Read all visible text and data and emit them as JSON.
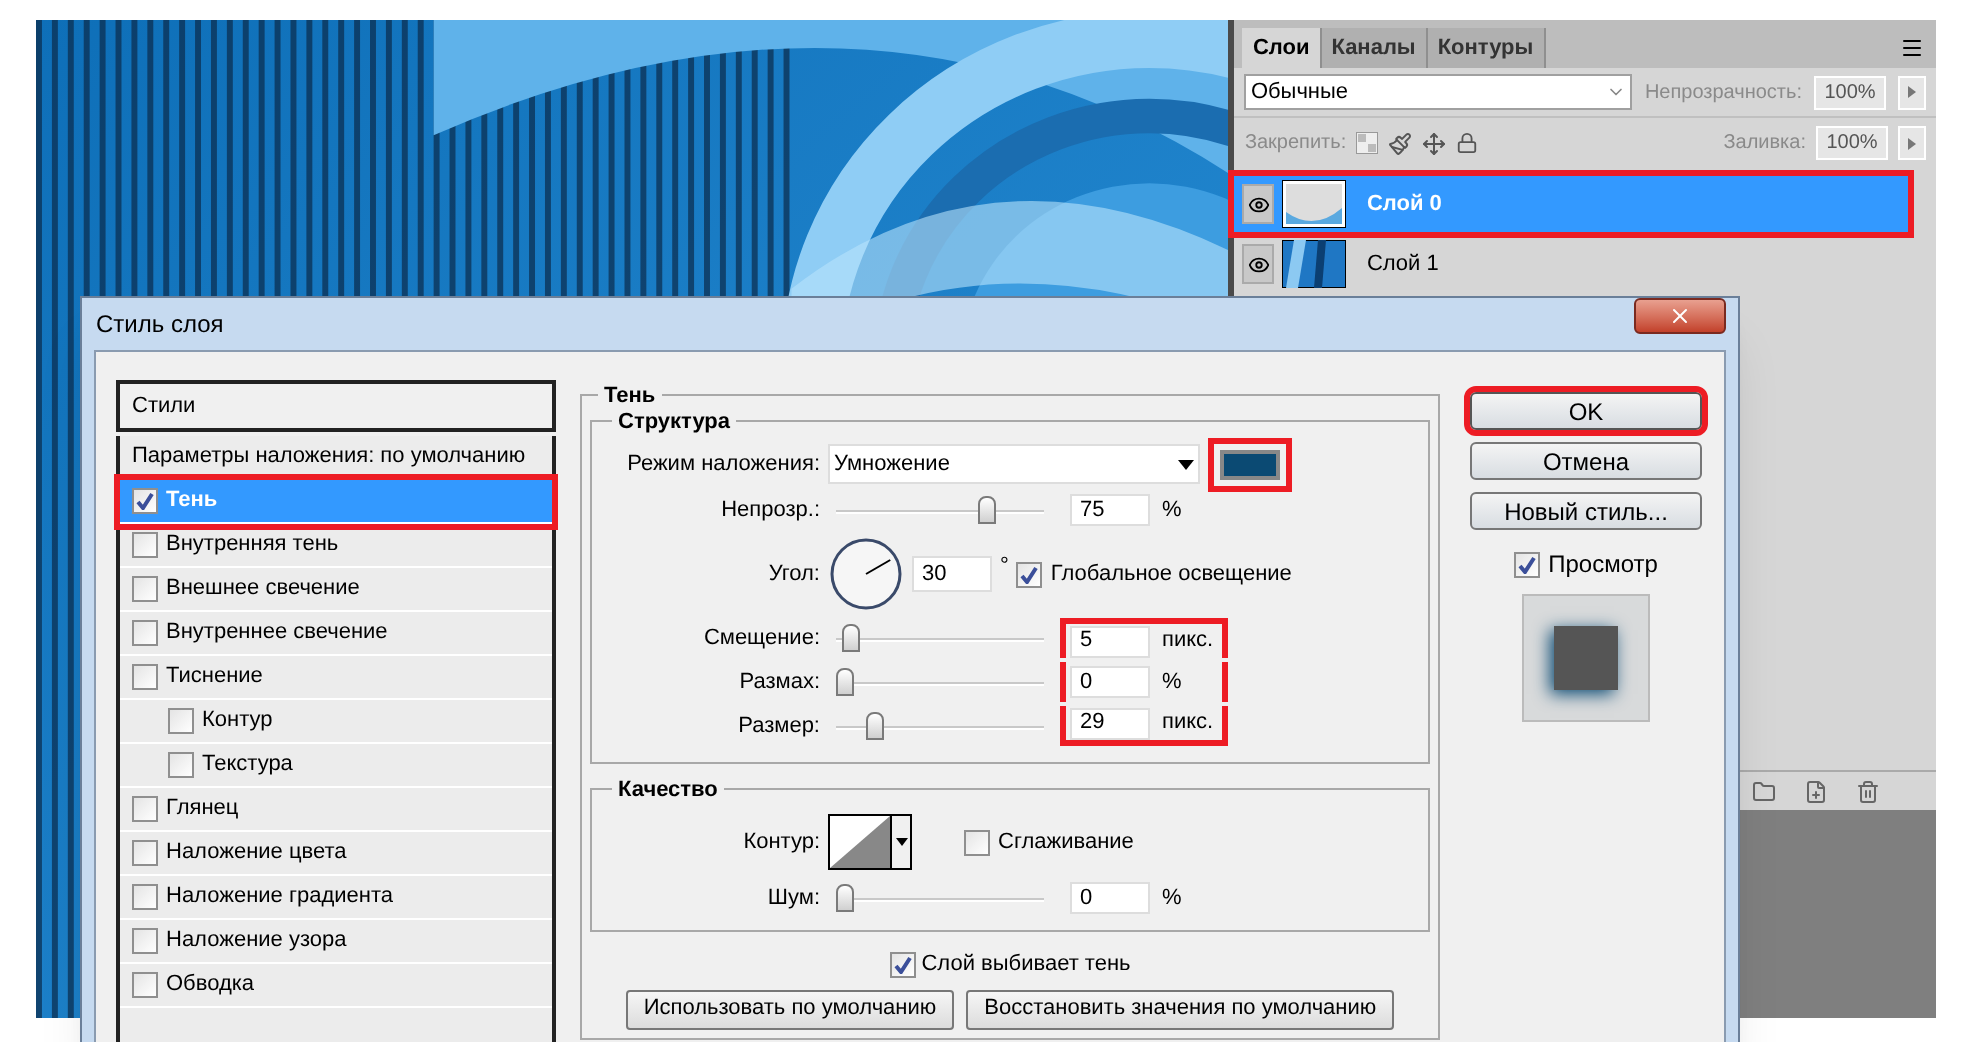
{
  "layers_panel": {
    "tabs": [
      {
        "label": "Слои",
        "selected": true
      },
      {
        "label": "Каналы",
        "selected": false
      },
      {
        "label": "Контуры",
        "selected": false
      }
    ],
    "blend_mode": "Обычные",
    "opacity_label": "Непрозрачность:",
    "opacity": "100%",
    "lock_label": "Закрепить:",
    "fill_label": "Заливка:",
    "fill": "100%",
    "layers": [
      {
        "name": "Слой 0",
        "kind": "transparent",
        "selected": true,
        "visible": true,
        "highlighted": true
      },
      {
        "name": "Слой 1",
        "selected": false,
        "visible": true,
        "highlighted": false
      }
    ]
  },
  "dialog": {
    "title": "Стиль слоя",
    "styles_header": "Стили",
    "blend_options": "Параметры наложения: по умолчанию",
    "styles": [
      {
        "label": "Тень",
        "checked": true,
        "selected": true,
        "highlighted": true
      },
      {
        "label": "Внутренняя тень",
        "checked": false,
        "selected": false,
        "highlighted": false
      },
      {
        "label": "Внешнее свечение",
        "checked": false,
        "selected": false,
        "highlighted": false
      },
      {
        "label": "Внутреннее свечение",
        "checked": false,
        "selected": false,
        "highlighted": false
      },
      {
        "label": "Тиснение",
        "checked": false,
        "selected": false,
        "highlighted": false,
        "children": [
          {
            "label": "Контур",
            "checked": false,
            "selected": false,
            "highlighted": false
          },
          {
            "label": "Текстура",
            "checked": false,
            "selected": false,
            "highlighted": false
          }
        ]
      },
      {
        "label": "Глянец",
        "checked": false,
        "selected": false,
        "highlighted": false
      },
      {
        "label": "Наложение цвета",
        "checked": false,
        "selected": false,
        "highlighted": false
      },
      {
        "label": "Наложение градиента",
        "checked": false,
        "selected": false,
        "highlighted": false
      },
      {
        "label": "Наложение узора",
        "checked": false,
        "selected": false,
        "highlighted": false
      },
      {
        "label": "Обводка",
        "checked": false,
        "selected": false,
        "highlighted": false
      }
    ],
    "section_title": "Тень",
    "structure": {
      "title": "Структура",
      "blend_label": "Режим наложения:",
      "blend_value": "Умножение",
      "color": "#0b4a73",
      "color_highlighted": true,
      "rows": [
        {
          "kind": "slider",
          "label": "Непрозр.:",
          "level": 0.75,
          "value": "75",
          "unit": "%",
          "highlighted": false
        },
        {
          "kind": "angle",
          "label": "Угол:",
          "value": "30",
          "unit": "°",
          "checkbox": {
            "label": "Глобальное освещение",
            "checked": true
          }
        },
        {
          "kind": "slider",
          "label": "Смещение:",
          "level": 0.03,
          "value": "5",
          "unit": "пикс.",
          "highlighted": true
        },
        {
          "kind": "slider",
          "label": "Размах:",
          "level": 0,
          "value": "0",
          "unit": "%",
          "highlighted": true
        },
        {
          "kind": "slider",
          "label": "Размер:",
          "level": 0.16,
          "value": "29",
          "unit": "пикс.",
          "highlighted": true
        }
      ]
    },
    "quality": {
      "title": "Качество",
      "contour_label": "Контур:",
      "antialias": {
        "label": "Сглаживание",
        "checked": false
      },
      "noise": {
        "label": "Шум:",
        "level": 0,
        "value": "0",
        "unit": "%"
      }
    },
    "knockout": {
      "label": "Слой выбивает тень",
      "checked": true
    },
    "bottom_buttons": [
      "Использовать по умолчанию",
      "Восстановить значения по умолчанию"
    ],
    "buttons": [
      {
        "label": "OK",
        "highlighted": true
      },
      {
        "label": "Отмена",
        "highlighted": false
      },
      {
        "label": "Новый стиль...",
        "highlighted": false
      }
    ],
    "preview": {
      "label": "Просмотр",
      "checked": true
    }
  }
}
